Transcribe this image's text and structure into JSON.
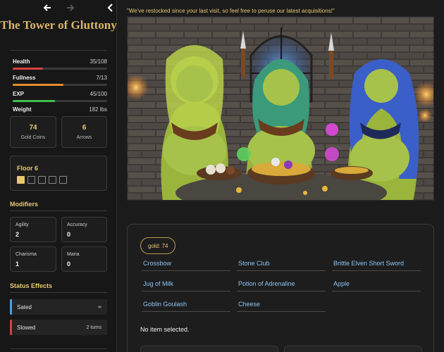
{
  "nav": {
    "back_icon": "arrow-left-icon",
    "forward_icon": "arrow-right-icon",
    "collapse_icon": "chevron-left-icon"
  },
  "sidebar": {
    "title": "The Tower of Gluttony",
    "stats": [
      {
        "label": "Health",
        "value": "35/108",
        "fraction": 0.324,
        "color": "#d94040"
      },
      {
        "label": "Fullness",
        "value": "7/13",
        "fraction": 0.538,
        "color": "#e88a2e"
      },
      {
        "label": "EXP",
        "value": "45/100",
        "fraction": 0.45,
        "color": "#3fbf4f"
      }
    ],
    "weight": {
      "label": "Weight",
      "value": "182 lbs"
    },
    "coins": {
      "value": "74",
      "label": "Gold Coins"
    },
    "arrows": {
      "value": "6",
      "label": "Arrows"
    },
    "floor": {
      "title": "Floor 6",
      "rooms_total": 5,
      "rooms_done": 1
    },
    "modifiers": {
      "heading": "Modifiers",
      "items": [
        {
          "label": "Agility",
          "value": "2"
        },
        {
          "label": "Accuracy",
          "value": "0"
        },
        {
          "label": "Charisma",
          "value": "1"
        },
        {
          "label": "Mana",
          "value": "0"
        }
      ]
    },
    "status_effects": {
      "heading": "Status Effects",
      "items": [
        {
          "label": "Sated",
          "duration": "∞",
          "color": "#4a9fe0"
        },
        {
          "label": "Slowed",
          "duration": "2 turns",
          "color": "#d94040"
        }
      ]
    }
  },
  "main": {
    "quote": "\"We've restocked since your last visit, so feel free to peruse our latest acquisitions!\"",
    "shop": {
      "gold_pill": "gold: 74",
      "items": [
        "Crossbow",
        "Stone Club",
        "Brittle Elven Short Sword",
        "Jug of Milk",
        "Potion of Adrenaline",
        "Apple",
        "Goblin Goulash",
        "Cheese"
      ],
      "selection": "No item selected."
    }
  }
}
